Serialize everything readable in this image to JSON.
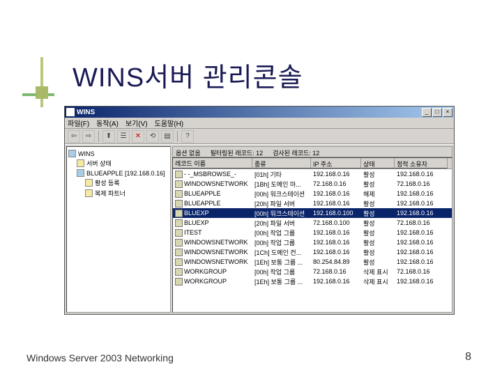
{
  "slide": {
    "title": "WINS서버 관리콘솔",
    "footer_left": "Windows  Server 2003 Networking",
    "footer_right": "8"
  },
  "window": {
    "title": "WINS",
    "menu": {
      "file": "파일(F)",
      "action": "동작(A)",
      "view": "보기(V)",
      "help": "도움말(H)"
    },
    "status": {
      "filter": "옵션 없음",
      "filtered": "필터링된 레코드: 12",
      "scanned": "검사된 레코드: 12"
    },
    "tree": {
      "root": "WINS",
      "server_status": "서버 상태",
      "server": "BLUEAPPLE [192.168.0.16]",
      "active": "활성 등록",
      "replication": "복제 파트너"
    },
    "columns": {
      "name": "레코드 이름",
      "type": "종류",
      "ip": "IP 주소",
      "state": "상태",
      "owner": "정적 소유자"
    },
    "rows": [
      {
        "name": "- -_MSBROWSE_-",
        "type": "[01h] 기타",
        "ip": "192.168.0.16",
        "state": "활성",
        "owner": "192.168.0.16"
      },
      {
        "name": "WINDOWSNETWORK",
        "type": "[1Bh] 도메인 마...",
        "ip": "72.168.0.16",
        "state": "활성",
        "owner": "72.168.0.16"
      },
      {
        "name": "BLUEAPPLE",
        "type": "[00h] 워크스테이션",
        "ip": "192.168.0.16",
        "state": "해제",
        "owner": "192.168.0.16"
      },
      {
        "name": "BLUEAPPLE",
        "type": "[20h] 파일 서버",
        "ip": "192.168.0.16",
        "state": "활성",
        "owner": "192.168.0.16"
      },
      {
        "name": "BLUEXP",
        "type": "[00h] 워크스테이션",
        "ip": "192.168.0.100",
        "state": "활성",
        "owner": "192.168.0.16",
        "selected": true
      },
      {
        "name": "BLUEXP",
        "type": "[20h] 파일 서버",
        "ip": "72.168.0.100",
        "state": "활성",
        "owner": "72.168.0.16"
      },
      {
        "name": "ITEST",
        "type": "[00h] 작업 그룹",
        "ip": "192.168.0.16",
        "state": "활성",
        "owner": "192.168.0.16"
      },
      {
        "name": "WINDOWSNETWORK",
        "type": "[00h] 작업 그룹",
        "ip": "192.168.0.16",
        "state": "활성",
        "owner": "192.168.0.16"
      },
      {
        "name": "WINDOWSNETWORK",
        "type": "[1Ch] 도메인 컨...",
        "ip": "192.168.0.16",
        "state": "활성",
        "owner": "192.168.0.16"
      },
      {
        "name": "WINDOWSNETWORK",
        "type": "[1Eh] 보통 그룹 ...",
        "ip": "80.254.84.89",
        "state": "활성",
        "owner": "192.168.0.16"
      },
      {
        "name": "WORKGROUP",
        "type": "[00h] 작업 그룹",
        "ip": "72.168.0.16",
        "state": "삭제 표시",
        "owner": "72.168.0.16"
      },
      {
        "name": "WORKGROUP",
        "type": "[1Eh] 보통 그룹 ...",
        "ip": "192.168.0.16",
        "state": "삭제 표시",
        "owner": "192.168.0.16"
      }
    ]
  }
}
